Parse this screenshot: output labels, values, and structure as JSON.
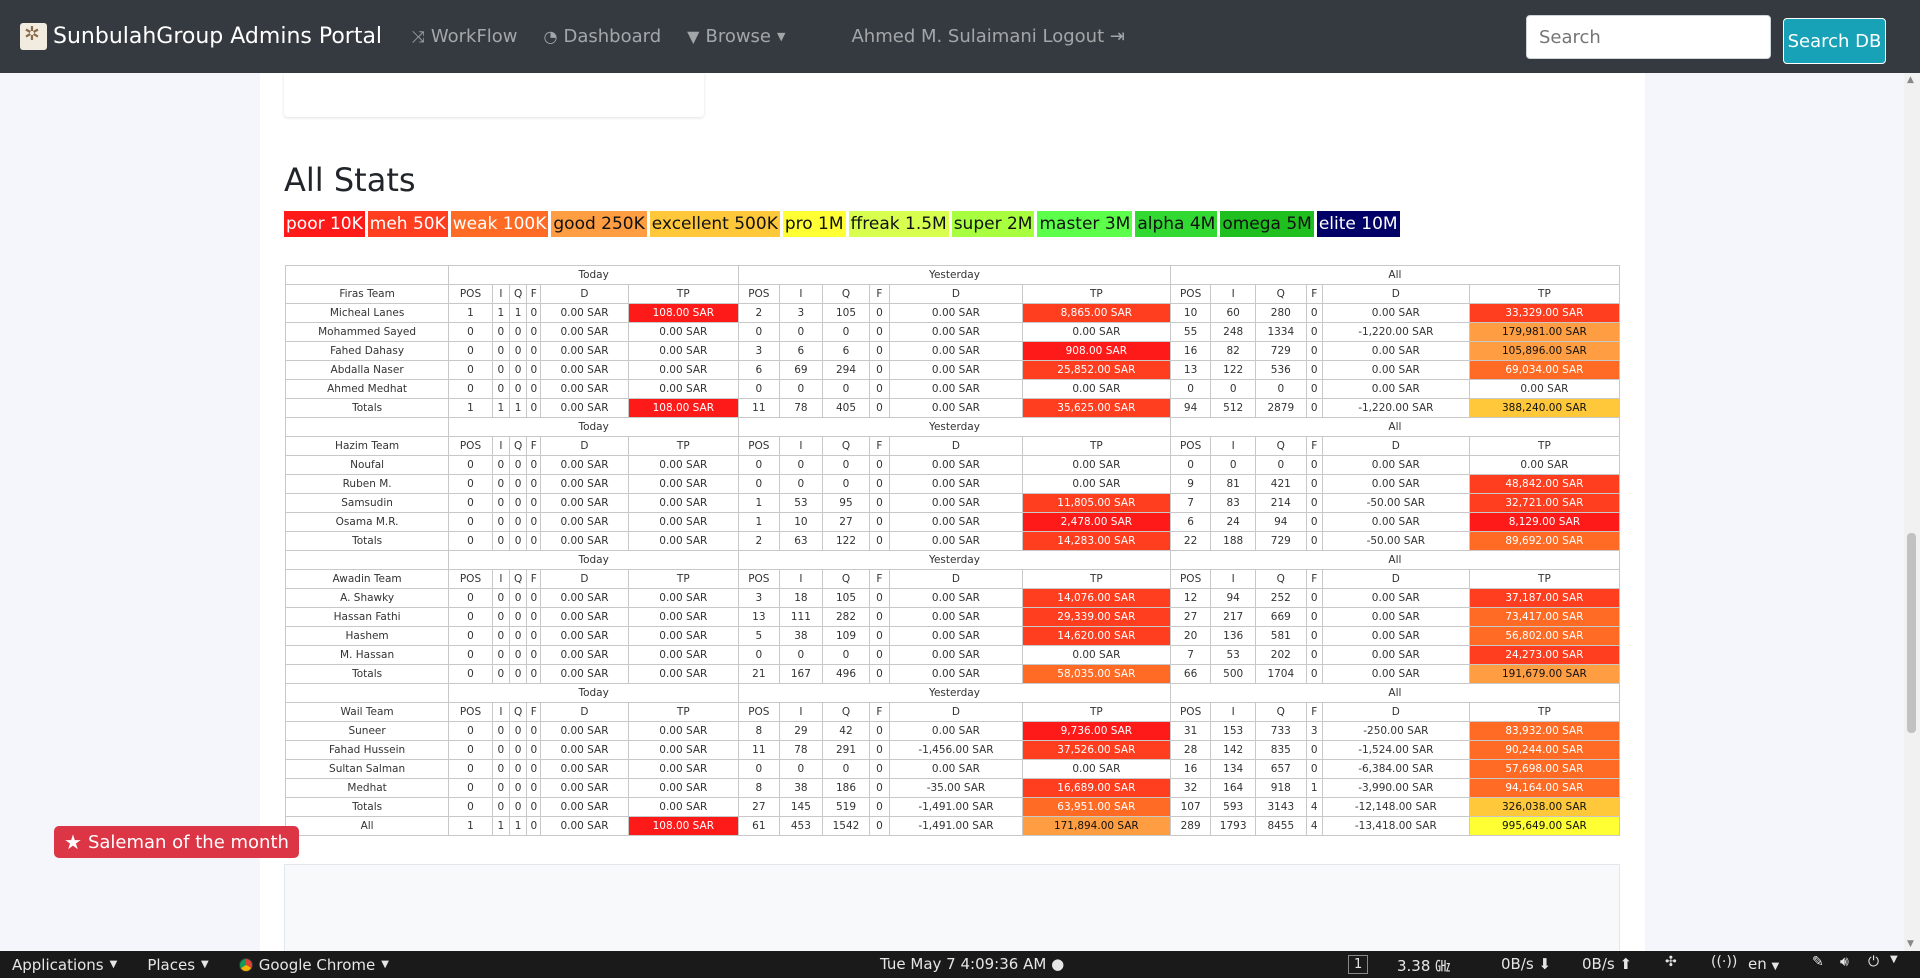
{
  "navbar": {
    "brand": "SunbulahGroup Admins Portal",
    "links": [
      {
        "label": "WorkFlow",
        "icon": "shuffle-icon"
      },
      {
        "label": "Dashboard",
        "icon": "dashboard-icon"
      },
      {
        "label": "Browse",
        "icon": "filter-icon"
      }
    ],
    "user": "Ahmed M. Sulaimani Logout",
    "search_placeholder": "Search",
    "search_button": "Search DB"
  },
  "page": {
    "heading": "All Stats",
    "legend": [
      {
        "label": "poor 10K",
        "bg": "#ff1a1a",
        "fg": "#ffffff"
      },
      {
        "label": "meh 50K",
        "bg": "#ff3d1f",
        "fg": "#ffffff"
      },
      {
        "label": "weak 100K",
        "bg": "#ff6b24",
        "fg": "#ffffff"
      },
      {
        "label": "good 250K",
        "bg": "#ff9d42",
        "fg": "#111111"
      },
      {
        "label": "excellent 500K",
        "bg": "#ffc83a",
        "fg": "#111111"
      },
      {
        "label": "pro 1M",
        "bg": "#ffff33",
        "fg": "#111111"
      },
      {
        "label": "ffreak 1.5M",
        "bg": "#d8ff4f",
        "fg": "#111111"
      },
      {
        "label": "super 2M",
        "bg": "#a8ff40",
        "fg": "#111111"
      },
      {
        "label": "master 3M",
        "bg": "#5cff4a",
        "fg": "#111111"
      },
      {
        "label": "alpha 4M",
        "bg": "#33d933",
        "fg": "#111111"
      },
      {
        "label": "omega 5M",
        "bg": "#1fbf1f",
        "fg": "#111111"
      },
      {
        "label": "elite 10M",
        "bg": "#000066",
        "fg": "#ffffff"
      }
    ],
    "salesman_label": "Saleman of the month"
  },
  "stats": {
    "period_labels": [
      "Today",
      "Yesterday",
      "All"
    ],
    "today_columns": [
      "POS",
      "I",
      "Q",
      "F",
      "D",
      "TP"
    ],
    "period_columns": [
      "POS",
      "I",
      "Q",
      "F",
      "D",
      "TP"
    ],
    "teams": [
      {
        "name": "Firas Team",
        "rows": [
          {
            "name": "Micheal Lanes",
            "today": [
              "1",
              "1",
              "1",
              "0",
              "0.00 SAR",
              "108.00 SAR"
            ],
            "yesterday": [
              "2",
              "3",
              "105",
              "0",
              "0.00 SAR",
              "8,865.00 SAR"
            ],
            "all": [
              "10",
              "60",
              "280",
              "0",
              "0.00 SAR",
              "33,329.00 SAR"
            ],
            "tp_colors": [
              "#ff1a1a",
              "#ff3d1f",
              "#ff3d1f"
            ]
          },
          {
            "name": "Mohammed Sayed",
            "today": [
              "0",
              "0",
              "0",
              "0",
              "0.00 SAR",
              "0.00 SAR"
            ],
            "yesterday": [
              "0",
              "0",
              "0",
              "0",
              "0.00 SAR",
              "0.00 SAR"
            ],
            "all": [
              "55",
              "248",
              "1334",
              "0",
              "-1,220.00 SAR",
              "179,981.00 SAR"
            ],
            "tp_colors": [
              "",
              "",
              "#ff9d42"
            ]
          },
          {
            "name": "Fahed Dahasy",
            "today": [
              "0",
              "0",
              "0",
              "0",
              "0.00 SAR",
              "0.00 SAR"
            ],
            "yesterday": [
              "3",
              "6",
              "6",
              "0",
              "0.00 SAR",
              "908.00 SAR"
            ],
            "all": [
              "16",
              "82",
              "729",
              "0",
              "0.00 SAR",
              "105,896.00 SAR"
            ],
            "tp_colors": [
              "",
              "#ff1a1a",
              "#ff9d42"
            ]
          },
          {
            "name": "Abdalla Naser",
            "today": [
              "0",
              "0",
              "0",
              "0",
              "0.00 SAR",
              "0.00 SAR"
            ],
            "yesterday": [
              "6",
              "69",
              "294",
              "0",
              "0.00 SAR",
              "25,852.00 SAR"
            ],
            "all": [
              "13",
              "122",
              "536",
              "0",
              "0.00 SAR",
              "69,034.00 SAR"
            ],
            "tp_colors": [
              "",
              "#ff3d1f",
              "#ff6b24"
            ]
          },
          {
            "name": "Ahmed Medhat",
            "today": [
              "0",
              "0",
              "0",
              "0",
              "0.00 SAR",
              "0.00 SAR"
            ],
            "yesterday": [
              "0",
              "0",
              "0",
              "0",
              "0.00 SAR",
              "0.00 SAR"
            ],
            "all": [
              "0",
              "0",
              "0",
              "0",
              "0.00 SAR",
              "0.00 SAR"
            ],
            "tp_colors": [
              "",
              "",
              ""
            ]
          },
          {
            "name": "Totals",
            "today": [
              "1",
              "1",
              "1",
              "0",
              "0.00 SAR",
              "108.00 SAR"
            ],
            "yesterday": [
              "11",
              "78",
              "405",
              "0",
              "0.00 SAR",
              "35,625.00 SAR"
            ],
            "all": [
              "94",
              "512",
              "2879",
              "0",
              "-1,220.00 SAR",
              "388,240.00 SAR"
            ],
            "tp_colors": [
              "#ff1a1a",
              "#ff3d1f",
              "#ffc83a"
            ]
          }
        ]
      },
      {
        "name": "Hazim Team",
        "rows": [
          {
            "name": "Noufal",
            "today": [
              "0",
              "0",
              "0",
              "0",
              "0.00 SAR",
              "0.00 SAR"
            ],
            "yesterday": [
              "0",
              "0",
              "0",
              "0",
              "0.00 SAR",
              "0.00 SAR"
            ],
            "all": [
              "0",
              "0",
              "0",
              "0",
              "0.00 SAR",
              "0.00 SAR"
            ],
            "tp_colors": [
              "",
              "",
              ""
            ]
          },
          {
            "name": "Ruben M.",
            "today": [
              "0",
              "0",
              "0",
              "0",
              "0.00 SAR",
              "0.00 SAR"
            ],
            "yesterday": [
              "0",
              "0",
              "0",
              "0",
              "0.00 SAR",
              "0.00 SAR"
            ],
            "all": [
              "9",
              "81",
              "421",
              "0",
              "0.00 SAR",
              "48,842.00 SAR"
            ],
            "tp_colors": [
              "",
              "",
              "#ff3d1f"
            ]
          },
          {
            "name": "Samsudin",
            "today": [
              "0",
              "0",
              "0",
              "0",
              "0.00 SAR",
              "0.00 SAR"
            ],
            "yesterday": [
              "1",
              "53",
              "95",
              "0",
              "0.00 SAR",
              "11,805.00 SAR"
            ],
            "all": [
              "7",
              "83",
              "214",
              "0",
              "-50.00 SAR",
              "32,721.00 SAR"
            ],
            "tp_colors": [
              "",
              "#ff3d1f",
              "#ff3d1f"
            ]
          },
          {
            "name": "Osama M.R.",
            "today": [
              "0",
              "0",
              "0",
              "0",
              "0.00 SAR",
              "0.00 SAR"
            ],
            "yesterday": [
              "1",
              "10",
              "27",
              "0",
              "0.00 SAR",
              "2,478.00 SAR"
            ],
            "all": [
              "6",
              "24",
              "94",
              "0",
              "0.00 SAR",
              "8,129.00 SAR"
            ],
            "tp_colors": [
              "",
              "#ff1a1a",
              "#ff1a1a"
            ]
          },
          {
            "name": "Totals",
            "today": [
              "0",
              "0",
              "0",
              "0",
              "0.00 SAR",
              "0.00 SAR"
            ],
            "yesterday": [
              "2",
              "63",
              "122",
              "0",
              "0.00 SAR",
              "14,283.00 SAR"
            ],
            "all": [
              "22",
              "188",
              "729",
              "0",
              "-50.00 SAR",
              "89,692.00 SAR"
            ],
            "tp_colors": [
              "",
              "#ff3d1f",
              "#ff6b24"
            ]
          }
        ]
      },
      {
        "name": "Awadin Team",
        "rows": [
          {
            "name": "A. Shawky",
            "today": [
              "0",
              "0",
              "0",
              "0",
              "0.00 SAR",
              "0.00 SAR"
            ],
            "yesterday": [
              "3",
              "18",
              "105",
              "0",
              "0.00 SAR",
              "14,076.00 SAR"
            ],
            "all": [
              "12",
              "94",
              "252",
              "0",
              "0.00 SAR",
              "37,187.00 SAR"
            ],
            "tp_colors": [
              "",
              "#ff3d1f",
              "#ff3d1f"
            ]
          },
          {
            "name": "Hassan Fathi",
            "today": [
              "0",
              "0",
              "0",
              "0",
              "0.00 SAR",
              "0.00 SAR"
            ],
            "yesterday": [
              "13",
              "111",
              "282",
              "0",
              "0.00 SAR",
              "29,339.00 SAR"
            ],
            "all": [
              "27",
              "217",
              "669",
              "0",
              "0.00 SAR",
              "73,417.00 SAR"
            ],
            "tp_colors": [
              "",
              "#ff3d1f",
              "#ff6b24"
            ]
          },
          {
            "name": "Hashem",
            "today": [
              "0",
              "0",
              "0",
              "0",
              "0.00 SAR",
              "0.00 SAR"
            ],
            "yesterday": [
              "5",
              "38",
              "109",
              "0",
              "0.00 SAR",
              "14,620.00 SAR"
            ],
            "all": [
              "20",
              "136",
              "581",
              "0",
              "0.00 SAR",
              "56,802.00 SAR"
            ],
            "tp_colors": [
              "",
              "#ff3d1f",
              "#ff6b24"
            ]
          },
          {
            "name": "M. Hassan",
            "today": [
              "0",
              "0",
              "0",
              "0",
              "0.00 SAR",
              "0.00 SAR"
            ],
            "yesterday": [
              "0",
              "0",
              "0",
              "0",
              "0.00 SAR",
              "0.00 SAR"
            ],
            "all": [
              "7",
              "53",
              "202",
              "0",
              "0.00 SAR",
              "24,273.00 SAR"
            ],
            "tp_colors": [
              "",
              "",
              "#ff3d1f"
            ]
          },
          {
            "name": "Totals",
            "today": [
              "0",
              "0",
              "0",
              "0",
              "0.00 SAR",
              "0.00 SAR"
            ],
            "yesterday": [
              "21",
              "167",
              "496",
              "0",
              "0.00 SAR",
              "58,035.00 SAR"
            ],
            "all": [
              "66",
              "500",
              "1704",
              "0",
              "0.00 SAR",
              "191,679.00 SAR"
            ],
            "tp_colors": [
              "",
              "#ff6b24",
              "#ff9d42"
            ]
          }
        ]
      },
      {
        "name": "Wail Team",
        "rows": [
          {
            "name": "Suneer",
            "today": [
              "0",
              "0",
              "0",
              "0",
              "0.00 SAR",
              "0.00 SAR"
            ],
            "yesterday": [
              "8",
              "29",
              "42",
              "0",
              "0.00 SAR",
              "9,736.00 SAR"
            ],
            "all": [
              "31",
              "153",
              "733",
              "3",
              "-250.00 SAR",
              "83,932.00 SAR"
            ],
            "tp_colors": [
              "",
              "#ff1a1a",
              "#ff6b24"
            ]
          },
          {
            "name": "Fahad Hussein",
            "today": [
              "0",
              "0",
              "0",
              "0",
              "0.00 SAR",
              "0.00 SAR"
            ],
            "yesterday": [
              "11",
              "78",
              "291",
              "0",
              "-1,456.00 SAR",
              "37,526.00 SAR"
            ],
            "all": [
              "28",
              "142",
              "835",
              "0",
              "-1,524.00 SAR",
              "90,244.00 SAR"
            ],
            "tp_colors": [
              "",
              "#ff3d1f",
              "#ff6b24"
            ]
          },
          {
            "name": "Sultan Salman",
            "today": [
              "0",
              "0",
              "0",
              "0",
              "0.00 SAR",
              "0.00 SAR"
            ],
            "yesterday": [
              "0",
              "0",
              "0",
              "0",
              "0.00 SAR",
              "0.00 SAR"
            ],
            "all": [
              "16",
              "134",
              "657",
              "0",
              "-6,384.00 SAR",
              "57,698.00 SAR"
            ],
            "tp_colors": [
              "",
              "",
              "#ff6b24"
            ]
          },
          {
            "name": "Medhat",
            "today": [
              "0",
              "0",
              "0",
              "0",
              "0.00 SAR",
              "0.00 SAR"
            ],
            "yesterday": [
              "8",
              "38",
              "186",
              "0",
              "-35.00 SAR",
              "16,689.00 SAR"
            ],
            "all": [
              "32",
              "164",
              "918",
              "1",
              "-3,990.00 SAR",
              "94,164.00 SAR"
            ],
            "tp_colors": [
              "",
              "#ff3d1f",
              "#ff6b24"
            ]
          },
          {
            "name": "Totals",
            "today": [
              "0",
              "0",
              "0",
              "0",
              "0.00 SAR",
              "0.00 SAR"
            ],
            "yesterday": [
              "27",
              "145",
              "519",
              "0",
              "-1,491.00 SAR",
              "63,951.00 SAR"
            ],
            "all": [
              "107",
              "593",
              "3143",
              "4",
              "-12,148.00 SAR",
              "326,038.00 SAR"
            ],
            "tp_colors": [
              "",
              "#ff6b24",
              "#ffc83a"
            ]
          }
        ]
      }
    ],
    "grand_total": {
      "name": "All",
      "today": [
        "1",
        "1",
        "1",
        "0",
        "0.00 SAR",
        "108.00 SAR"
      ],
      "yesterday": [
        "61",
        "453",
        "1542",
        "0",
        "-1,491.00 SAR",
        "171,894.00 SAR"
      ],
      "all": [
        "289",
        "1793",
        "8455",
        "4",
        "-13,418.00 SAR",
        "995,649.00 SAR"
      ],
      "tp_colors": [
        "#ff1a1a",
        "#ff9d42",
        "#ffff33"
      ]
    }
  },
  "taskbar": {
    "applications": "Applications",
    "places": "Places",
    "browser": "Google Chrome",
    "clock": "Tue May 7  4:09:36 AM",
    "workspace": "1",
    "cpu": "3.38 ㎓",
    "net_down": "0B/s",
    "net_up": "0B/s",
    "lang": "en"
  }
}
